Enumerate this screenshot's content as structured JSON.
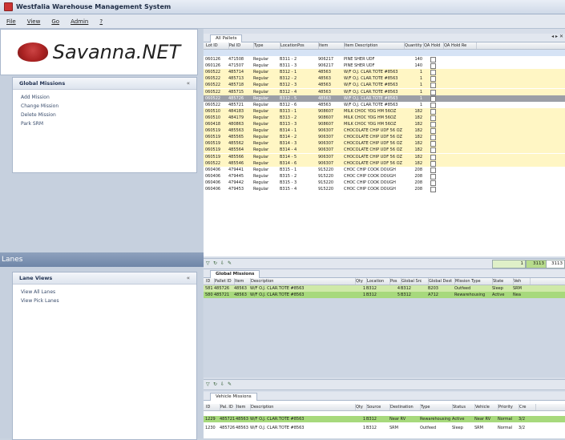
{
  "app": {
    "title": "Westfalia Warehouse Management System"
  },
  "menu": [
    "File",
    "View",
    "Go",
    "Admin",
    "?"
  ],
  "logo": {
    "text": "Savanna.NET"
  },
  "global_missions": {
    "title": "Global Missions",
    "links": [
      "Add Mission",
      "Change Mission",
      "Delete Mission",
      "Park SRM"
    ]
  },
  "lanes": {
    "title": "Lanes",
    "views_title": "Lane Views",
    "links": [
      "View All Lanes",
      "View Pick Lanes"
    ]
  },
  "pallets": {
    "tab": "All Pallets",
    "columns": [
      "Lot ID",
      "Pal ID",
      "Type",
      "LocationPos",
      "Item",
      "Item Description",
      "Quantity",
      "QA Hold",
      "QA Hold Re"
    ],
    "rows": [
      {
        "lot": "060126",
        "pal": "471508",
        "type": "Regular",
        "loc": "B311 - 2",
        "item": "906217",
        "desc": "PINE SHER     UDF",
        "qty": "140",
        "c": "w"
      },
      {
        "lot": "060126",
        "pal": "471507",
        "type": "Regular",
        "loc": "B311 - 3",
        "item": "906217",
        "desc": "PINE SHER     UDF",
        "qty": "140",
        "c": "w"
      },
      {
        "lot": "060522",
        "pal": "485714",
        "type": "Regular",
        "loc": "B312 - 1",
        "item": "48563",
        "desc": "W/F O.J. CLAR.TOTE #8563",
        "qty": "1",
        "c": "y"
      },
      {
        "lot": "060522",
        "pal": "485713",
        "type": "Regular",
        "loc": "B312 - 2",
        "item": "48563",
        "desc": "W/F O.J. CLAR.TOTE #8563",
        "qty": "1",
        "c": "y"
      },
      {
        "lot": "060522",
        "pal": "485718",
        "type": "Regular",
        "loc": "B312 - 3",
        "item": "48563",
        "desc": "W/F O.J. CLAR.TOTE #8563",
        "qty": "1",
        "c": "y"
      },
      {
        "lot": "060522",
        "pal": "485715",
        "type": "Regular",
        "loc": "B312 - 4",
        "item": "48563",
        "desc": "W/F O.J. CLAR.TOTE #8563",
        "qty": "1",
        "c": "y"
      },
      {
        "lot": "060522",
        "pal": "485726",
        "type": "Regular",
        "loc": "B312 - 5",
        "item": "48563",
        "desc": "W/F O.J. CLAR.TOTE #8563",
        "qty": "1",
        "c": "s"
      },
      {
        "lot": "060522",
        "pal": "485721",
        "type": "Regular",
        "loc": "B312 - 6",
        "item": "48563",
        "desc": "W/F O.J. CLAR.TOTE #8563",
        "qty": "1",
        "c": "w"
      },
      {
        "lot": "060510",
        "pal": "484183",
        "type": "Regular",
        "loc": "B313 - 1",
        "item": "908607",
        "desc": "MILK CHOC YOG HM 56OZ",
        "qty": "182",
        "c": "y"
      },
      {
        "lot": "060510",
        "pal": "484179",
        "type": "Regular",
        "loc": "B313 - 2",
        "item": "908607",
        "desc": "MILK CHOC YOG HM 56OZ",
        "qty": "182",
        "c": "y"
      },
      {
        "lot": "060418",
        "pal": "480863",
        "type": "Regular",
        "loc": "B313 - 3",
        "item": "908607",
        "desc": "MILK CHOC YOG HM 56OZ",
        "qty": "182",
        "c": "y"
      },
      {
        "lot": "060519",
        "pal": "485563",
        "type": "Regular",
        "loc": "B314 - 1",
        "item": "906307",
        "desc": "CHOCOLATE CHIP UDF 56 OZ",
        "qty": "182",
        "c": "y"
      },
      {
        "lot": "060519",
        "pal": "485565",
        "type": "Regular",
        "loc": "B314 - 2",
        "item": "906307",
        "desc": "CHOCOLATE CHIP UDF 56 OZ",
        "qty": "182",
        "c": "y"
      },
      {
        "lot": "060519",
        "pal": "485562",
        "type": "Regular",
        "loc": "B314 - 3",
        "item": "906307",
        "desc": "CHOCOLATE CHIP UDF 56 OZ",
        "qty": "182",
        "c": "y"
      },
      {
        "lot": "060519",
        "pal": "485564",
        "type": "Regular",
        "loc": "B314 - 4",
        "item": "906307",
        "desc": "CHOCOLATE CHIP UDF 56 OZ",
        "qty": "182",
        "c": "y"
      },
      {
        "lot": "060519",
        "pal": "485566",
        "type": "Regular",
        "loc": "B314 - 5",
        "item": "906307",
        "desc": "CHOCOLATE CHIP UDF 56 OZ",
        "qty": "182",
        "c": "y"
      },
      {
        "lot": "060522",
        "pal": "485546",
        "type": "Regular",
        "loc": "B314 - 6",
        "item": "906307",
        "desc": "CHOCOLATE CHIP UDF 56 OZ",
        "qty": "182",
        "c": "y"
      },
      {
        "lot": "060406",
        "pal": "479441",
        "type": "Regular",
        "loc": "B315 - 1",
        "item": "915220",
        "desc": "CHOC CHIP COOK DOUGH",
        "qty": "208",
        "c": "w"
      },
      {
        "lot": "060406",
        "pal": "479445",
        "type": "Regular",
        "loc": "B315 - 2",
        "item": "915220",
        "desc": "CHOC CHIP COOK DOUGH",
        "qty": "208",
        "c": "w"
      },
      {
        "lot": "060406",
        "pal": "479442",
        "type": "Regular",
        "loc": "B315 - 3",
        "item": "915220",
        "desc": "CHOC CHIP COOK DOUGH",
        "qty": "208",
        "c": "w"
      },
      {
        "lot": "060406",
        "pal": "479453",
        "type": "Regular",
        "loc": "B315 - 4",
        "item": "915220",
        "desc": "CHOC CHIP COOK DOUGH",
        "qty": "208",
        "c": "w"
      }
    ],
    "footer": {
      "a": "1",
      "b": "3113",
      "c": "3113"
    }
  },
  "gm_grid": {
    "title": "Global Missions",
    "columns": [
      "ID",
      "Pallet ID",
      "Item",
      "Description",
      "Qty",
      "Location",
      "Pos",
      "Global Src",
      "Global Dest",
      "Mission Type",
      "State",
      "Veh"
    ],
    "rows": [
      {
        "id": "581",
        "pal": "485726",
        "item": "48563",
        "desc": "W/F O.J. CLAR.TOTE #8563",
        "qty": "1",
        "loc": "B312",
        "pos": "4",
        "src": "B312",
        "dest": "B203",
        "type": "Outfeed",
        "state": "Sleep",
        "veh": "SRM",
        "c": "g"
      },
      {
        "id": "580",
        "pal": "485721",
        "item": "48563",
        "desc": "W/F O.J. CLAR.TOTE #8563",
        "qty": "1",
        "loc": "B312",
        "pos": "5",
        "src": "B312",
        "dest": "A712",
        "type": "Rewarehousing",
        "state": "Active",
        "veh": "Nea",
        "c": "g2"
      }
    ]
  },
  "vm_grid": {
    "tab": "Vehicle Missions",
    "columns": [
      "ID",
      "Pal. ID",
      "Item",
      "Description",
      "Qty",
      "Source",
      "Destination",
      "Type",
      "Status",
      "Vehicle",
      "Priority",
      "Cre"
    ],
    "rows": [
      {
        "id": "1229",
        "pal": "485721",
        "item": "48563",
        "desc": "W/F O.J. CLAR.TOTE #8563",
        "qty": "1",
        "src": "B312",
        "dest": "Near RV",
        "type": "Rewarehousing",
        "status": "Active",
        "veh": "Near RV",
        "pri": "Normal",
        "cre": "3/2",
        "c": "g2"
      },
      {
        "id": "1230",
        "pal": "485726",
        "item": "48563",
        "desc": "W/F O.J. CLAR.TOTE #8563",
        "qty": "1",
        "src": "B312",
        "dest": "SRM",
        "type": "Outfeed",
        "status": "Sleep",
        "veh": "SRM",
        "pri": "Normal",
        "cre": "3/2",
        "c": "w"
      }
    ]
  }
}
